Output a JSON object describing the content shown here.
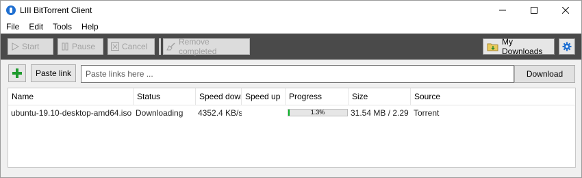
{
  "window": {
    "title": "LIII BitTorrent Client"
  },
  "menu": [
    "File",
    "Edit",
    "Tools",
    "Help"
  ],
  "toolbar": {
    "start": "Start",
    "pause": "Pause",
    "cancel": "Cancel",
    "remove_completed": "Remove completed",
    "my_downloads": "My Downloads"
  },
  "paste": {
    "paste_link": "Paste link",
    "placeholder": "Paste links here ...",
    "download": "Download"
  },
  "table": {
    "columns": [
      "Name",
      "Status",
      "Speed down",
      "Speed up",
      "Progress",
      "Size",
      "Source"
    ],
    "rows": [
      {
        "name": "ubuntu-19.10-desktop-amd64.iso",
        "status": "Downloading",
        "speed_down": "4352.4 KB/s",
        "speed_up": "",
        "progress_label": "1.3%",
        "progress_value": 0.013,
        "size": "31.54 MB / 2.29 ...",
        "source": "Torrent"
      }
    ]
  },
  "colors": {
    "toolbar_bg": "#4a4a4a",
    "progress_fill": "#06b025",
    "accent": "#1f6fd1"
  }
}
